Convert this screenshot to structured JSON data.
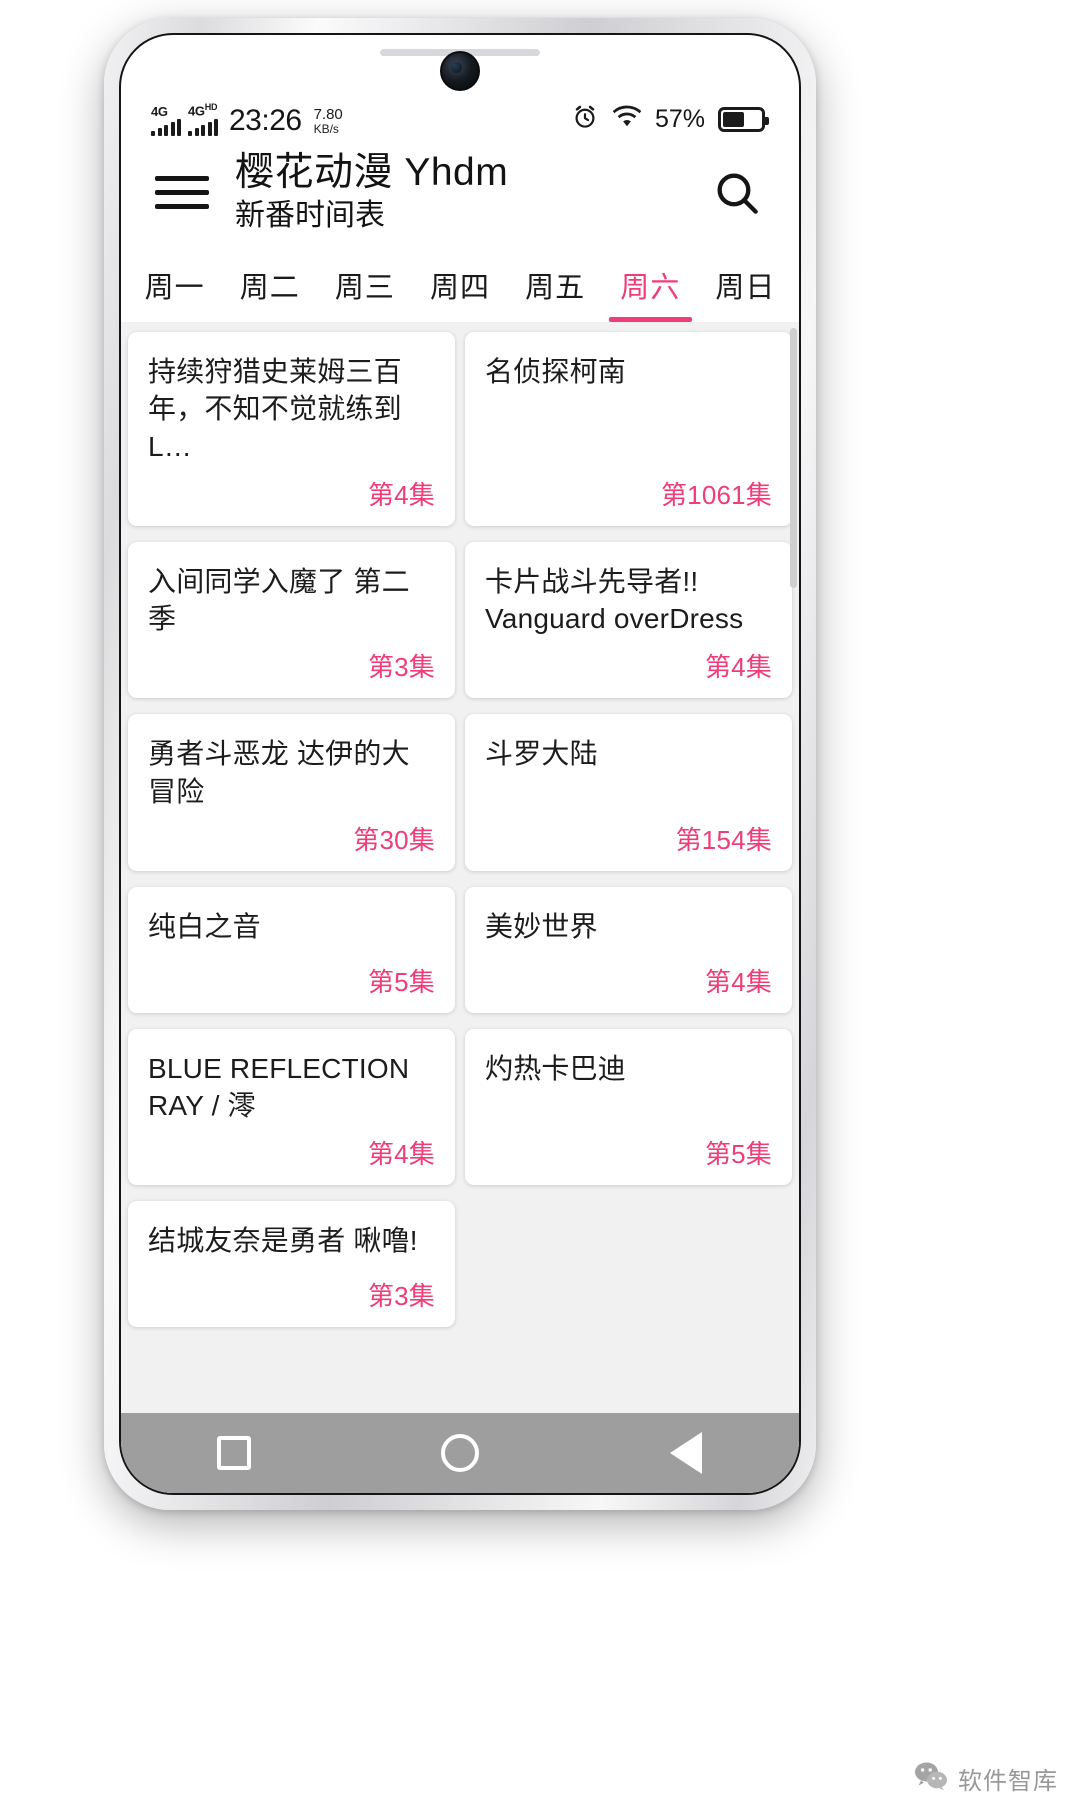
{
  "statusbar": {
    "network_1": "4G",
    "network_1_sup": "",
    "network_2": "4G",
    "network_2_sup": "HD",
    "time": "23:26",
    "speed_value": "7.80",
    "speed_unit": "KB/s",
    "alarm_icon": "alarm-clock-icon",
    "wifi_icon": "wifi-icon",
    "battery_percent": "57%",
    "battery_icon": "battery-icon"
  },
  "appbar": {
    "menu_icon": "hamburger-menu-icon",
    "title": "樱花动漫 Yhdm",
    "subtitle": "新番时间表",
    "search_icon": "search-icon"
  },
  "tabs": [
    {
      "label": "周一",
      "active": false
    },
    {
      "label": "周二",
      "active": false
    },
    {
      "label": "周三",
      "active": false
    },
    {
      "label": "周四",
      "active": false
    },
    {
      "label": "周五",
      "active": false
    },
    {
      "label": "周六",
      "active": true
    },
    {
      "label": "周日",
      "active": false
    }
  ],
  "accent_color": "#ee3d78",
  "shows": [
    {
      "title": "持续狩猎史莱姆三百年，不知不觉就练到L…",
      "episode": "第4集"
    },
    {
      "title": "名侦探柯南",
      "episode": "第1061集"
    },
    {
      "title": "入间同学入魔了 第二季",
      "episode": "第3集"
    },
    {
      "title": "卡片战斗先导者!! Vanguard overDress",
      "episode": "第4集"
    },
    {
      "title": "勇者斗恶龙 达伊的大冒险",
      "episode": "第30集"
    },
    {
      "title": "斗罗大陆",
      "episode": "第154集"
    },
    {
      "title": "纯白之音",
      "episode": "第5集"
    },
    {
      "title": "美妙世界",
      "episode": "第4集"
    },
    {
      "title": "BLUE REFLECTION RAY / 澪",
      "episode": "第4集"
    },
    {
      "title": "灼热卡巴迪",
      "episode": "第5集"
    },
    {
      "title": "结城友奈是勇者 啾噜!",
      "episode": "第3集"
    }
  ],
  "navbar": {
    "recents_icon": "square-recents-icon",
    "home_icon": "circle-home-icon",
    "back_icon": "triangle-back-icon"
  },
  "watermark": {
    "icon": "wechat-icon",
    "text": "软件智库"
  }
}
